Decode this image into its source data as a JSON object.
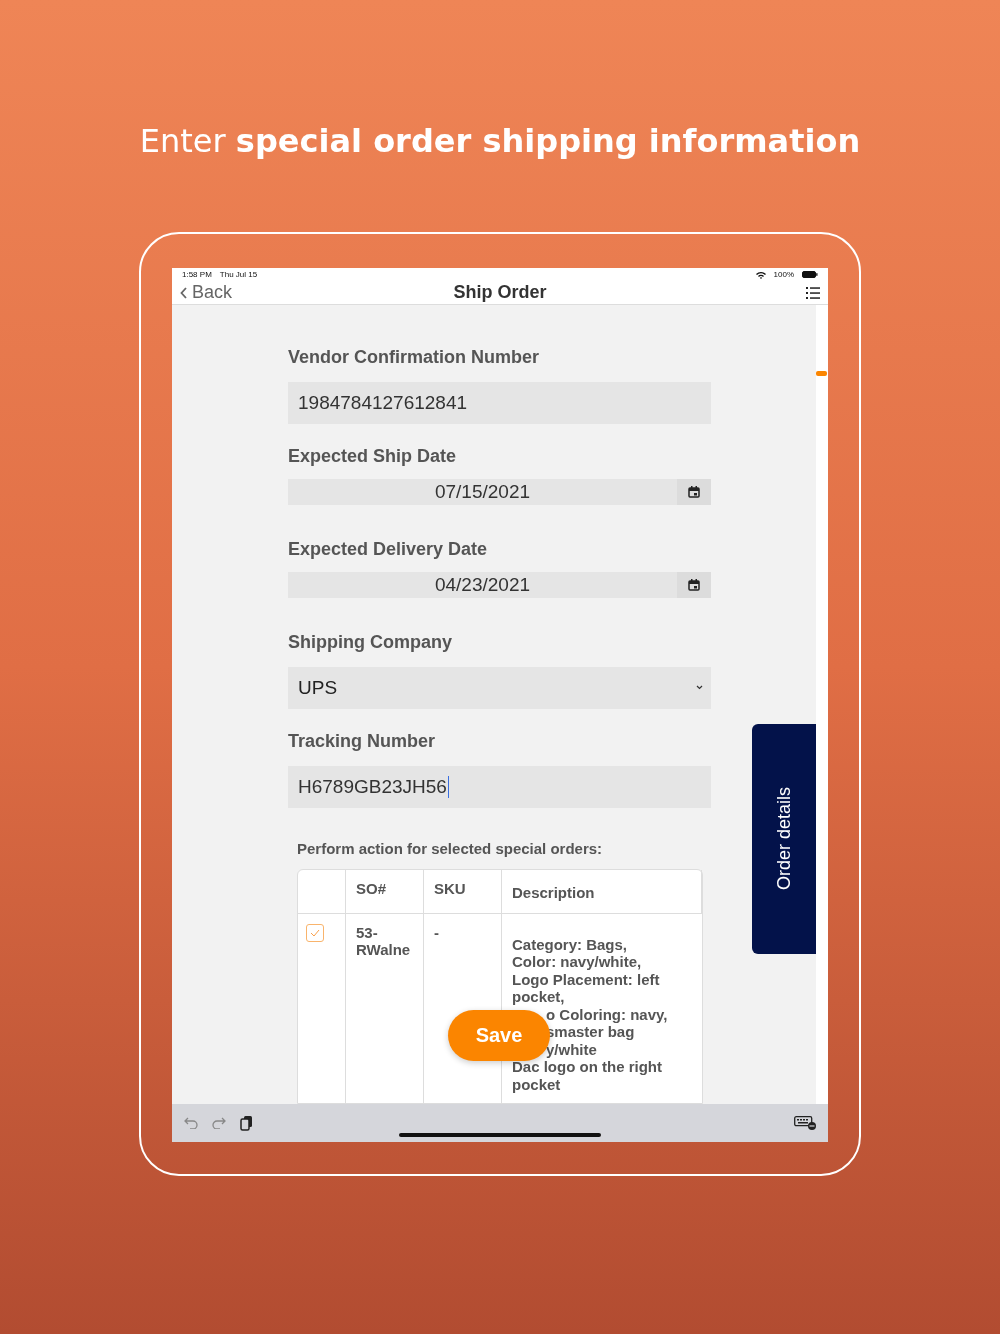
{
  "headline": "Enter **special order shipping information**",
  "status_bar": {
    "time": "1:58 PM",
    "date": "Thu Jul 15",
    "battery": "100%"
  },
  "nav": {
    "back": "Back",
    "title": "Ship Order"
  },
  "fields": [
    {
      "kind": "text",
      "label": "Vendor Confirmation Number",
      "value": "1984784127612841"
    },
    {
      "kind": "date",
      "label": "Expected Ship Date",
      "value": "07/15/2021"
    },
    {
      "kind": "date",
      "label": "Expected Delivery Date",
      "value": "04/23/2021"
    },
    {
      "kind": "select",
      "label": "Shipping Company",
      "value": "UPS"
    },
    {
      "kind": "text",
      "label": "Tracking Number",
      "value": "H6789GB23JH56",
      "focused": true
    }
  ],
  "table": {
    "caption": "Perform action for selected special orders:",
    "columns": [
      "SO#",
      "SKU",
      "Description"
    ],
    "rows": [
      {
        "checked": true,
        "so": "53-RWalne",
        "sku": "-",
        "description": [
          {
            "text": "Category: Bags,",
            "covered": false
          },
          {
            "text": "Color: navy/white,",
            "covered": false
          },
          {
            "text": "Logo Placement: left",
            "covered": false
          },
          {
            "text": "pocket,",
            "covered": false
          },
          {
            "text": "o Coloring: navy,",
            "covered": true
          },
          {
            "text": "smaster bag",
            "covered": true
          },
          {
            "text": "y/white",
            "covered": true
          },
          {
            "text": "Dac logo on the right",
            "covered": false
          },
          {
            "text": "pocket",
            "covered": false
          }
        ]
      }
    ]
  },
  "save": "Save",
  "side_tab": "Order details"
}
